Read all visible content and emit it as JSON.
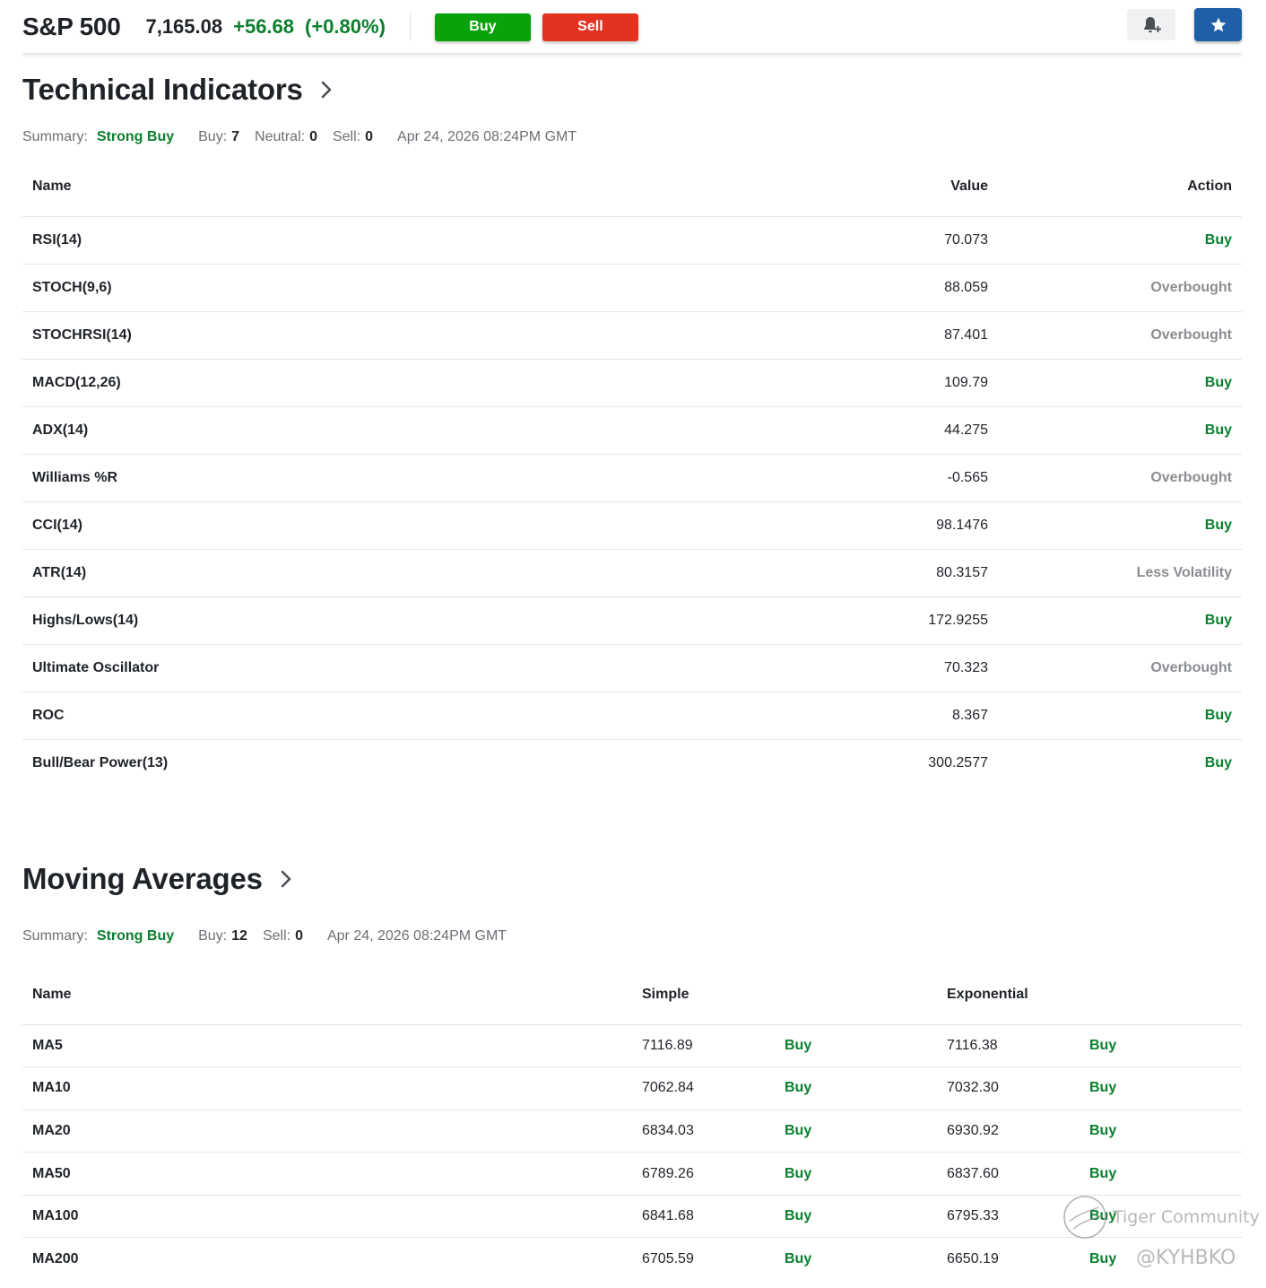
{
  "header": {
    "symbol": "S&P 500",
    "price": "7,165.08",
    "change": "+56.68",
    "change_pct": "(+0.80%)",
    "buy_label": "Buy",
    "sell_label": "Sell",
    "alert_icon": "bell-plus-icon",
    "watchlist_icon": "star-icon"
  },
  "colors": {
    "positive": "#0a7f2e",
    "buy_button": "#0aa20a",
    "sell_button": "#e3321f",
    "star_button": "#1f5fa8"
  },
  "technical_indicators": {
    "title": "Technical Indicators",
    "summary_label": "Summary:",
    "summary_value": "Strong Buy",
    "buy_label": "Buy:",
    "buy_count": "7",
    "neutral_label": "Neutral:",
    "neutral_count": "0",
    "sell_label": "Sell:",
    "sell_count": "0",
    "timestamp": "Apr 24, 2026 08:24PM GMT",
    "columns": {
      "name": "Name",
      "value": "Value",
      "action": "Action"
    },
    "rows": [
      {
        "name": "RSI(14)",
        "value": "70.073",
        "action": "Buy",
        "kind": "buy"
      },
      {
        "name": "STOCH(9,6)",
        "value": "88.059",
        "action": "Overbought",
        "kind": "neutral"
      },
      {
        "name": "STOCHRSI(14)",
        "value": "87.401",
        "action": "Overbought",
        "kind": "neutral"
      },
      {
        "name": "MACD(12,26)",
        "value": "109.79",
        "action": "Buy",
        "kind": "buy"
      },
      {
        "name": "ADX(14)",
        "value": "44.275",
        "action": "Buy",
        "kind": "buy"
      },
      {
        "name": "Williams %R",
        "value": "-0.565",
        "action": "Overbought",
        "kind": "neutral"
      },
      {
        "name": "CCI(14)",
        "value": "98.1476",
        "action": "Buy",
        "kind": "buy"
      },
      {
        "name": "ATR(14)",
        "value": "80.3157",
        "action": "Less Volatility",
        "kind": "neutral"
      },
      {
        "name": "Highs/Lows(14)",
        "value": "172.9255",
        "action": "Buy",
        "kind": "buy"
      },
      {
        "name": "Ultimate Oscillator",
        "value": "70.323",
        "action": "Overbought",
        "kind": "neutral"
      },
      {
        "name": "ROC",
        "value": "8.367",
        "action": "Buy",
        "kind": "buy"
      },
      {
        "name": "Bull/Bear Power(13)",
        "value": "300.2577",
        "action": "Buy",
        "kind": "buy"
      }
    ]
  },
  "moving_averages": {
    "title": "Moving Averages",
    "summary_label": "Summary:",
    "summary_value": "Strong Buy",
    "buy_label": "Buy:",
    "buy_count": "12",
    "sell_label": "Sell:",
    "sell_count": "0",
    "timestamp": "Apr 24, 2026 08:24PM GMT",
    "columns": {
      "name": "Name",
      "simple": "Simple",
      "exponential": "Exponential"
    },
    "rows": [
      {
        "name": "MA5",
        "simple": "7116.89",
        "simple_action": "Buy",
        "exp": "7116.38",
        "exp_action": "Buy"
      },
      {
        "name": "MA10",
        "simple": "7062.84",
        "simple_action": "Buy",
        "exp": "7032.30",
        "exp_action": "Buy"
      },
      {
        "name": "MA20",
        "simple": "6834.03",
        "simple_action": "Buy",
        "exp": "6930.92",
        "exp_action": "Buy"
      },
      {
        "name": "MA50",
        "simple": "6789.26",
        "simple_action": "Buy",
        "exp": "6837.60",
        "exp_action": "Buy"
      },
      {
        "name": "MA100",
        "simple": "6841.68",
        "simple_action": "Buy",
        "exp": "6795.33",
        "exp_action": "Buy"
      },
      {
        "name": "MA200",
        "simple": "6705.59",
        "simple_action": "Buy",
        "exp": "6650.19",
        "exp_action": "Buy"
      }
    ]
  },
  "watermark": {
    "line1": "Tiger Community",
    "line2": "@KYHBKO"
  }
}
